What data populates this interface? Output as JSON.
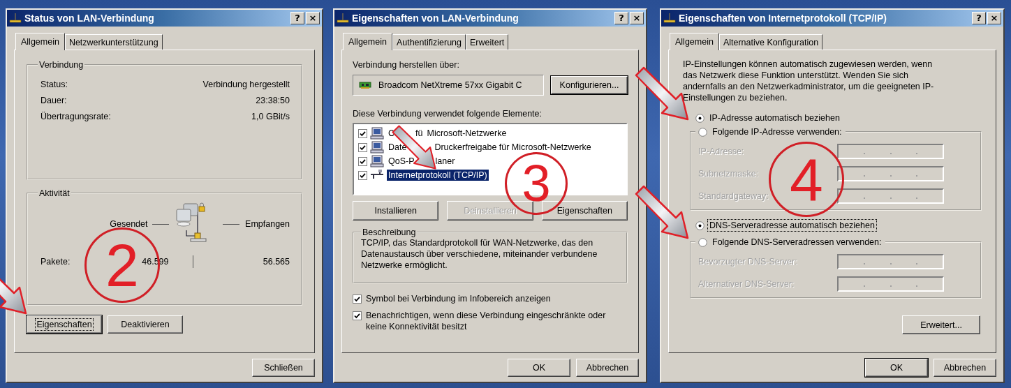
{
  "status_dialog": {
    "title": "Status von LAN-Verbindung",
    "title_buttons": [
      "?",
      "×"
    ],
    "tabs": [
      {
        "label": "Allgemein",
        "selected": true
      },
      {
        "label": "Netzwerkunterstützung",
        "selected": false
      }
    ],
    "connection": {
      "legend": "Verbindung",
      "rows": [
        {
          "label": "Status:",
          "value": "Verbindung hergestellt"
        },
        {
          "label": "Dauer:",
          "value": "23:38:50"
        },
        {
          "label": "Übertragungsrate:",
          "value": "1,0 GBit/s"
        }
      ]
    },
    "activity": {
      "legend": "Aktivität",
      "sent_label": "Gesendet",
      "received_label": "Empfangen",
      "packets_label": "Pakete:",
      "packets_sent": "46.599",
      "packets_received": "56.565"
    },
    "buttons": [
      {
        "label": "Eigenschaften",
        "default": true,
        "focused": true
      },
      {
        "label": "Deaktivieren",
        "default": false,
        "focused": false
      }
    ],
    "close_button": {
      "label": "Schließen"
    }
  },
  "lan_dialog": {
    "title": "Eigenschaften von LAN-Verbindung",
    "title_buttons": [
      "?",
      "×"
    ],
    "tabs": [
      {
        "label": "Allgemein",
        "selected": true
      },
      {
        "label": "Authentifizierung",
        "selected": false
      },
      {
        "label": "Erweitert",
        "selected": false
      }
    ],
    "connect_via_label": "Verbindung herstellen über:",
    "adapter": "Broadcom NetXtreme 57xx Gigabit C",
    "configure_button": "Konfigurieren...",
    "components_label": "Diese Verbindung verwendet folgende Elemente:",
    "components": [
      {
        "label_parts": [
          "C",
          "fü",
          "Microsoft-Netzwerke"
        ],
        "kind": "computer",
        "checked": true,
        "selected": false
      },
      {
        "label_parts": [
          "Date",
          "Druckerfreigabe für Microsoft-Netzwerke"
        ],
        "kind": "computer",
        "checked": true,
        "selected": false
      },
      {
        "label_parts": [
          "QoS-P",
          "laner"
        ],
        "kind": "computer",
        "checked": true,
        "selected": false
      },
      {
        "label_parts": [
          "Internetprotokoll (TCP/IP)"
        ],
        "kind": "protocol",
        "checked": true,
        "selected": true
      }
    ],
    "buttons": [
      {
        "label": "Installieren",
        "disabled": false
      },
      {
        "label": "Deinstallieren",
        "disabled": true
      },
      {
        "label": "Eigenschaften",
        "disabled": false
      }
    ],
    "description": {
      "legend": "Beschreibung",
      "text": "TCP/IP, das Standardprotokoll für WAN-Netzwerke, das den Datenaustausch über verschiedene, miteinander verbundene Netzwerke ermöglicht."
    },
    "options": [
      {
        "label": "Symbol bei Verbindung im Infobereich anzeigen",
        "checked": true
      },
      {
        "label": "Benachrichtigen, wenn diese Verbindung eingeschränkte oder keine Konnektivität besitzt",
        "checked": true
      }
    ],
    "footer_buttons": [
      {
        "label": "OK",
        "default": false
      },
      {
        "label": "Abbrechen",
        "default": false
      }
    ]
  },
  "tcpip_dialog": {
    "title": "Eigenschaften von Internetprotokoll (TCP/IP)",
    "title_buttons": [
      "?",
      "×"
    ],
    "tabs": [
      {
        "label": "Allgemein",
        "selected": true
      },
      {
        "label": "Alternative Konfiguration",
        "selected": false
      }
    ],
    "intro": "IP-Einstellungen können automatisch zugewiesen werden, wenn das Netzwerk diese Funktion unterstützt. Wenden Sie sich andernfalls an den Netzwerkadministrator, um die geeigneten IP-Einstellungen zu beziehen.",
    "ip_auto": {
      "label": "IP-Adresse automatisch beziehen",
      "selected": true
    },
    "ip_manual": {
      "label": "Folgende IP-Adresse verwenden:",
      "selected": false,
      "fields": [
        {
          "label": "IP-Adresse:",
          "disabled": true
        },
        {
          "label": "Subnetzmaske:",
          "disabled": true
        },
        {
          "label": "Standardgateway:",
          "disabled": true
        }
      ]
    },
    "dns_auto": {
      "label": "DNS-Serveradresse automatisch beziehen",
      "selected": true,
      "focused": true
    },
    "dns_manual": {
      "label": "Folgende DNS-Serveradressen verwenden:",
      "selected": false,
      "fields": [
        {
          "label": "Bevorzugter DNS-Server:",
          "disabled": true
        },
        {
          "label": "Alternativer DNS-Server:",
          "disabled": true
        }
      ]
    },
    "advanced_button": "Erweitert...",
    "footer_buttons": [
      {
        "label": "OK",
        "default": true
      },
      {
        "label": "Abbrechen",
        "default": false
      }
    ]
  },
  "annotations": [
    {
      "label": "2"
    },
    {
      "label": "3"
    },
    {
      "label": "4"
    }
  ]
}
